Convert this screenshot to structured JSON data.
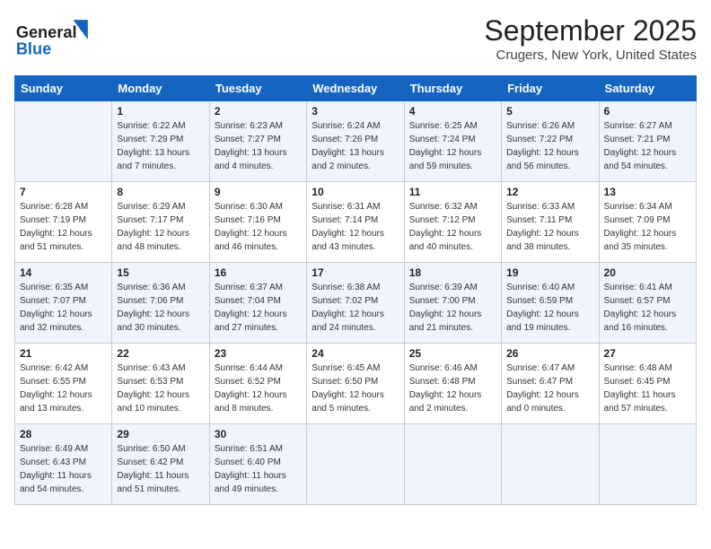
{
  "header": {
    "logo_general": "General",
    "logo_blue": "Blue",
    "month": "September 2025",
    "location": "Crugers, New York, United States"
  },
  "days_of_week": [
    "Sunday",
    "Monday",
    "Tuesday",
    "Wednesday",
    "Thursday",
    "Friday",
    "Saturday"
  ],
  "weeks": [
    [
      {
        "day": "",
        "sunrise": "",
        "sunset": "",
        "daylight": ""
      },
      {
        "day": "1",
        "sunrise": "Sunrise: 6:22 AM",
        "sunset": "Sunset: 7:29 PM",
        "daylight": "Daylight: 13 hours and 7 minutes."
      },
      {
        "day": "2",
        "sunrise": "Sunrise: 6:23 AM",
        "sunset": "Sunset: 7:27 PM",
        "daylight": "Daylight: 13 hours and 4 minutes."
      },
      {
        "day": "3",
        "sunrise": "Sunrise: 6:24 AM",
        "sunset": "Sunset: 7:26 PM",
        "daylight": "Daylight: 13 hours and 2 minutes."
      },
      {
        "day": "4",
        "sunrise": "Sunrise: 6:25 AM",
        "sunset": "Sunset: 7:24 PM",
        "daylight": "Daylight: 12 hours and 59 minutes."
      },
      {
        "day": "5",
        "sunrise": "Sunrise: 6:26 AM",
        "sunset": "Sunset: 7:22 PM",
        "daylight": "Daylight: 12 hours and 56 minutes."
      },
      {
        "day": "6",
        "sunrise": "Sunrise: 6:27 AM",
        "sunset": "Sunset: 7:21 PM",
        "daylight": "Daylight: 12 hours and 54 minutes."
      }
    ],
    [
      {
        "day": "7",
        "sunrise": "Sunrise: 6:28 AM",
        "sunset": "Sunset: 7:19 PM",
        "daylight": "Daylight: 12 hours and 51 minutes."
      },
      {
        "day": "8",
        "sunrise": "Sunrise: 6:29 AM",
        "sunset": "Sunset: 7:17 PM",
        "daylight": "Daylight: 12 hours and 48 minutes."
      },
      {
        "day": "9",
        "sunrise": "Sunrise: 6:30 AM",
        "sunset": "Sunset: 7:16 PM",
        "daylight": "Daylight: 12 hours and 46 minutes."
      },
      {
        "day": "10",
        "sunrise": "Sunrise: 6:31 AM",
        "sunset": "Sunset: 7:14 PM",
        "daylight": "Daylight: 12 hours and 43 minutes."
      },
      {
        "day": "11",
        "sunrise": "Sunrise: 6:32 AM",
        "sunset": "Sunset: 7:12 PM",
        "daylight": "Daylight: 12 hours and 40 minutes."
      },
      {
        "day": "12",
        "sunrise": "Sunrise: 6:33 AM",
        "sunset": "Sunset: 7:11 PM",
        "daylight": "Daylight: 12 hours and 38 minutes."
      },
      {
        "day": "13",
        "sunrise": "Sunrise: 6:34 AM",
        "sunset": "Sunset: 7:09 PM",
        "daylight": "Daylight: 12 hours and 35 minutes."
      }
    ],
    [
      {
        "day": "14",
        "sunrise": "Sunrise: 6:35 AM",
        "sunset": "Sunset: 7:07 PM",
        "daylight": "Daylight: 12 hours and 32 minutes."
      },
      {
        "day": "15",
        "sunrise": "Sunrise: 6:36 AM",
        "sunset": "Sunset: 7:06 PM",
        "daylight": "Daylight: 12 hours and 30 minutes."
      },
      {
        "day": "16",
        "sunrise": "Sunrise: 6:37 AM",
        "sunset": "Sunset: 7:04 PM",
        "daylight": "Daylight: 12 hours and 27 minutes."
      },
      {
        "day": "17",
        "sunrise": "Sunrise: 6:38 AM",
        "sunset": "Sunset: 7:02 PM",
        "daylight": "Daylight: 12 hours and 24 minutes."
      },
      {
        "day": "18",
        "sunrise": "Sunrise: 6:39 AM",
        "sunset": "Sunset: 7:00 PM",
        "daylight": "Daylight: 12 hours and 21 minutes."
      },
      {
        "day": "19",
        "sunrise": "Sunrise: 6:40 AM",
        "sunset": "Sunset: 6:59 PM",
        "daylight": "Daylight: 12 hours and 19 minutes."
      },
      {
        "day": "20",
        "sunrise": "Sunrise: 6:41 AM",
        "sunset": "Sunset: 6:57 PM",
        "daylight": "Daylight: 12 hours and 16 minutes."
      }
    ],
    [
      {
        "day": "21",
        "sunrise": "Sunrise: 6:42 AM",
        "sunset": "Sunset: 6:55 PM",
        "daylight": "Daylight: 12 hours and 13 minutes."
      },
      {
        "day": "22",
        "sunrise": "Sunrise: 6:43 AM",
        "sunset": "Sunset: 6:53 PM",
        "daylight": "Daylight: 12 hours and 10 minutes."
      },
      {
        "day": "23",
        "sunrise": "Sunrise: 6:44 AM",
        "sunset": "Sunset: 6:52 PM",
        "daylight": "Daylight: 12 hours and 8 minutes."
      },
      {
        "day": "24",
        "sunrise": "Sunrise: 6:45 AM",
        "sunset": "Sunset: 6:50 PM",
        "daylight": "Daylight: 12 hours and 5 minutes."
      },
      {
        "day": "25",
        "sunrise": "Sunrise: 6:46 AM",
        "sunset": "Sunset: 6:48 PM",
        "daylight": "Daylight: 12 hours and 2 minutes."
      },
      {
        "day": "26",
        "sunrise": "Sunrise: 6:47 AM",
        "sunset": "Sunset: 6:47 PM",
        "daylight": "Daylight: 12 hours and 0 minutes."
      },
      {
        "day": "27",
        "sunrise": "Sunrise: 6:48 AM",
        "sunset": "Sunset: 6:45 PM",
        "daylight": "Daylight: 11 hours and 57 minutes."
      }
    ],
    [
      {
        "day": "28",
        "sunrise": "Sunrise: 6:49 AM",
        "sunset": "Sunset: 6:43 PM",
        "daylight": "Daylight: 11 hours and 54 minutes."
      },
      {
        "day": "29",
        "sunrise": "Sunrise: 6:50 AM",
        "sunset": "Sunset: 6:42 PM",
        "daylight": "Daylight: 11 hours and 51 minutes."
      },
      {
        "day": "30",
        "sunrise": "Sunrise: 6:51 AM",
        "sunset": "Sunset: 6:40 PM",
        "daylight": "Daylight: 11 hours and 49 minutes."
      },
      {
        "day": "",
        "sunrise": "",
        "sunset": "",
        "daylight": ""
      },
      {
        "day": "",
        "sunrise": "",
        "sunset": "",
        "daylight": ""
      },
      {
        "day": "",
        "sunrise": "",
        "sunset": "",
        "daylight": ""
      },
      {
        "day": "",
        "sunrise": "",
        "sunset": "",
        "daylight": ""
      }
    ]
  ]
}
